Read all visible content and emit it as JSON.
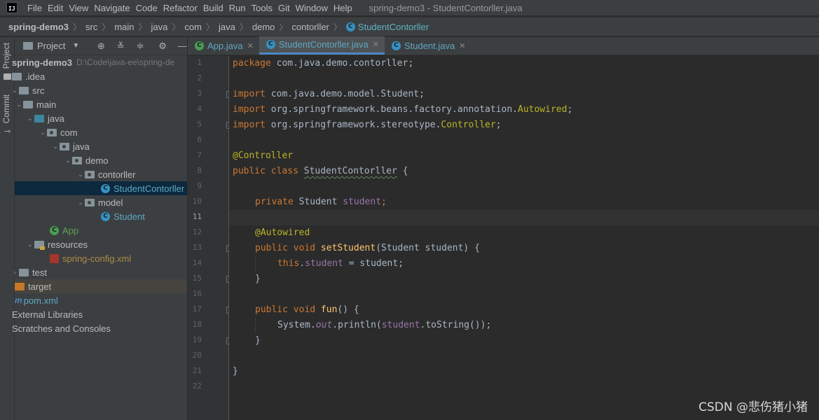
{
  "menubar": {
    "logo": "IJ",
    "items": [
      "File",
      "Edit",
      "View",
      "Navigate",
      "Code",
      "Refactor",
      "Build",
      "Run",
      "Tools",
      "Git",
      "Window",
      "Help"
    ],
    "window_title": "spring-demo3 - StudentContorller.java"
  },
  "breadcrumb": {
    "items": [
      "spring-demo3",
      "src",
      "main",
      "java",
      "com",
      "java",
      "demo",
      "contorller"
    ],
    "current": "StudentContorller"
  },
  "side_strip": {
    "project_tab": "Project",
    "commit_tab": "Commit"
  },
  "project_panel": {
    "title": "Project",
    "tree": [
      {
        "label": "spring-demo3",
        "path": "D:\\Code\\java-ee\\spring-de",
        "style": "root"
      },
      {
        "label": ".idea",
        "style": "folder"
      },
      {
        "label": "src",
        "style": "folder"
      },
      {
        "label": "main",
        "style": "folder"
      },
      {
        "label": "java",
        "style": "blue-folder"
      },
      {
        "label": "com",
        "style": "package"
      },
      {
        "label": "java",
        "style": "package"
      },
      {
        "label": "demo",
        "style": "package"
      },
      {
        "label": "contorller",
        "style": "package"
      },
      {
        "label": "StudentContorller",
        "style": "class"
      },
      {
        "label": "model",
        "style": "package"
      },
      {
        "label": "Student",
        "style": "class"
      },
      {
        "label": "App",
        "style": "app"
      },
      {
        "label": "resources",
        "style": "resources"
      },
      {
        "label": "spring-config.xml",
        "style": "xml"
      },
      {
        "label": "test",
        "style": "folder"
      },
      {
        "label": "target",
        "style": "excluded"
      },
      {
        "label": "pom.xml",
        "style": "maven"
      },
      {
        "label": "External Libraries",
        "style": "plain"
      },
      {
        "label": "Scratches and Consoles",
        "style": "plain"
      }
    ]
  },
  "tabs": [
    {
      "label": "App.java",
      "active": false
    },
    {
      "label": "StudentContorller.java",
      "active": true
    },
    {
      "label": "Student.java",
      "active": false
    }
  ],
  "editor": {
    "current_line": 11,
    "line_numbers": [
      "1",
      "2",
      "3",
      "4",
      "5",
      "6",
      "7",
      "8",
      "9",
      "10",
      "11",
      "12",
      "13",
      "14",
      "15",
      "16",
      "17",
      "18",
      "19",
      "20",
      "21",
      "22"
    ],
    "code": {
      "l1_kw": "package",
      "l1_rest": " com.java.demo.contorller;",
      "l3_kw": "import",
      "l3_rest": " com.java.demo.model.Student;",
      "l4_kw": "import",
      "l4_a": " org.springframework.beans.factory.annotation.",
      "l4_b": "Autowired",
      "l4_c": ";",
      "l5_kw": "import",
      "l5_a": " org.springframework.stereotype.",
      "l5_b": "Controller",
      "l5_c": ";",
      "l7": "@Controller",
      "l8_kw": "public class",
      "l8_name": "StudentContorller",
      "l8_rest": " {",
      "l10_kw": "private",
      "l10_type": " Student ",
      "l10_fld": "student",
      "l10_end": ";",
      "l12": "@Autowired",
      "l13_kw": "public void",
      "l13_fn": "setStudent",
      "l13_rest": "(Student student) {",
      "l14_kw": "this",
      "l14_dot": ".",
      "l14_fld": "student",
      "l14_rest": " = student;",
      "l15": "}",
      "l17_kw": "public void",
      "l17_fn": "fun",
      "l17_rest": "() {",
      "l18_a": "System.",
      "l18_out": "out",
      "l18_b": ".println(",
      "l18_fld": "student",
      "l18_c": ".toString());",
      "l19": "}",
      "l21": "}"
    }
  },
  "watermark": "CSDN @悲伤猪小猪",
  "colors": {
    "keyword": "#cc7832",
    "annotation": "#bbb529",
    "field": "#9876aa",
    "method": "#ffc66d",
    "text": "#a9b7c6",
    "background": "#2b2b2b"
  }
}
